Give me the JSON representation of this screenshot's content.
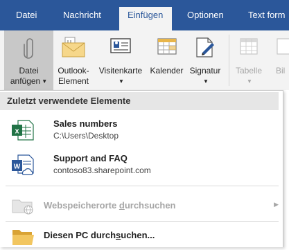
{
  "tabs": [
    {
      "label": "Datei",
      "active": false
    },
    {
      "label": "Nachricht",
      "active": false
    },
    {
      "label": "Einfügen",
      "active": true
    },
    {
      "label": "Optionen",
      "active": false
    },
    {
      "label": "Text form",
      "active": false
    }
  ],
  "ribbon": {
    "attach_file": {
      "line1": "Datei",
      "line2": "anfügen",
      "icon": "paperclip-icon"
    },
    "outlook_item": {
      "line1": "Outlook-",
      "line2": "Element",
      "icon": "envelope-icon"
    },
    "business_card": {
      "line1": "Visitenkarte",
      "icon": "business-card-icon"
    },
    "calendar": {
      "line1": "Kalender",
      "icon": "calendar-icon"
    },
    "signature": {
      "line1": "Signatur",
      "icon": "signature-icon"
    },
    "table": {
      "line1": "Tabelle",
      "icon": "table-icon"
    },
    "pictures": {
      "line1": "Bil",
      "icon": "picture-icon"
    }
  },
  "dropdown": {
    "section_header": "Zuletzt verwendete Elemente",
    "recent_items": [
      {
        "name": "Sales numbers",
        "path": "C:\\Users\\Desktop",
        "icon": "excel-file-icon"
      },
      {
        "name": "Support and FAQ",
        "path": "contoso83.sharepoint.com",
        "icon": "word-file-icon"
      }
    ],
    "browse_web": {
      "before": "Webspeicherorte ",
      "underlined": "d",
      "after": "urchsuchen",
      "enabled": false
    },
    "browse_pc": {
      "before": "Diesen PC durch",
      "underlined": "s",
      "after": "uchen..."
    }
  },
  "colors": {
    "tabbar": "#2b579a",
    "ribbon": "#f3f3f3",
    "excel_green": "#217346",
    "word_blue": "#2b579a",
    "folder_yellow": "#e8b54a"
  }
}
